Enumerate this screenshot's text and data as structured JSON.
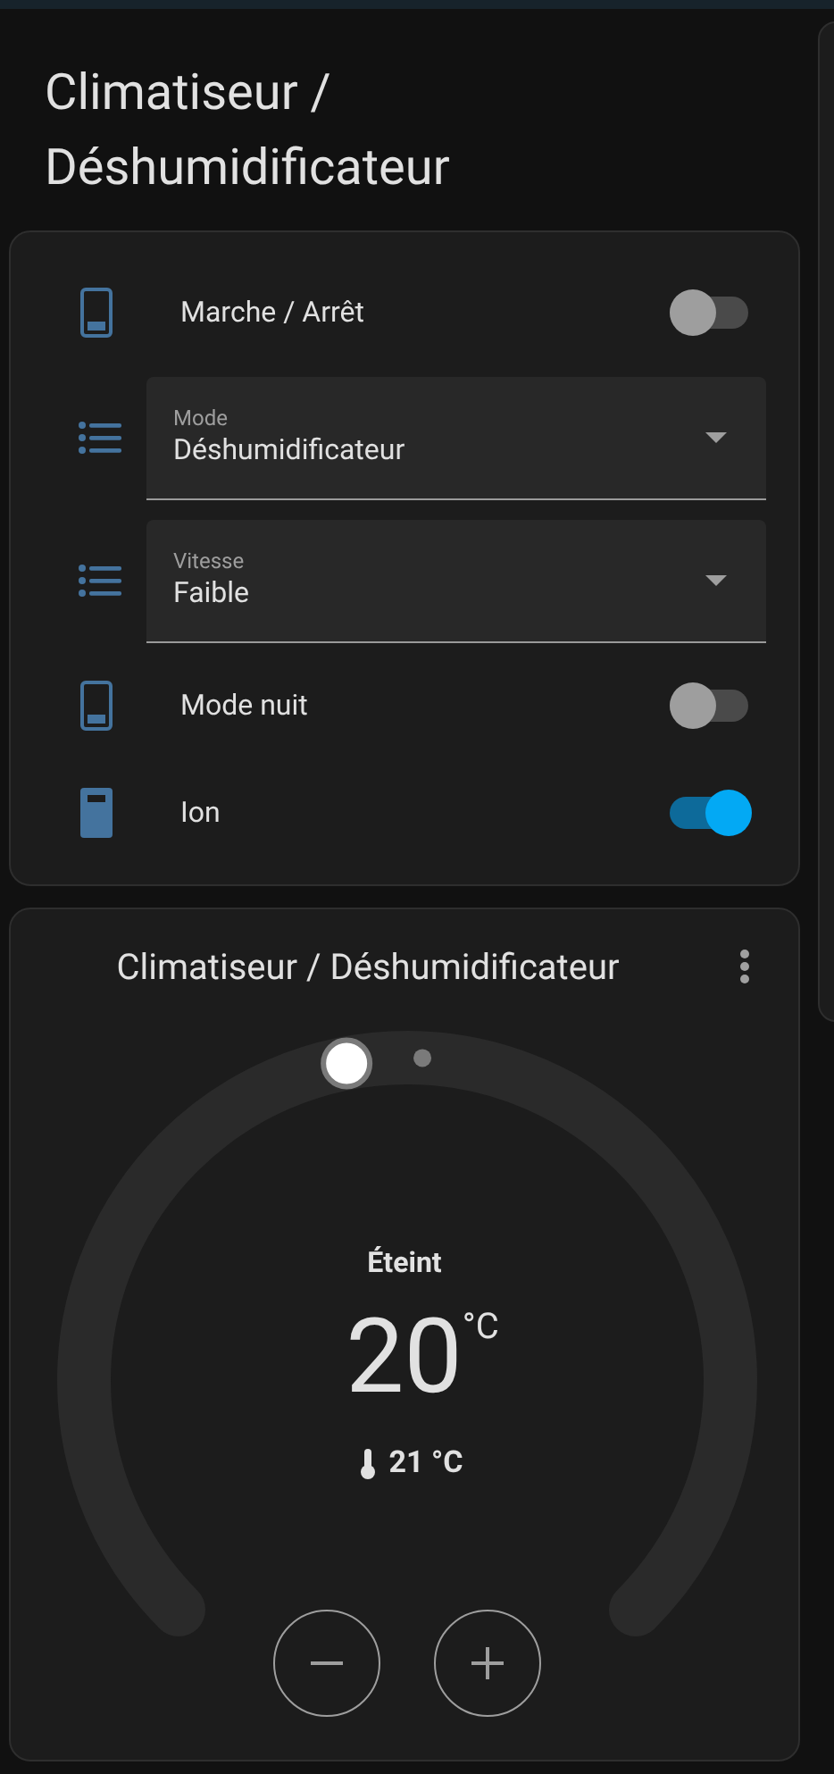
{
  "title": "Climatiseur / Déshumidificateur",
  "entities": [
    {
      "kind": "switch",
      "label": "Marche / Arrêt",
      "on": false
    },
    {
      "kind": "select",
      "label": "Mode",
      "value": "Déshumidificateur"
    },
    {
      "kind": "select",
      "label": "Vitesse",
      "value": "Faible"
    },
    {
      "kind": "switch",
      "label": "Mode nuit",
      "on": false
    },
    {
      "kind": "switch",
      "label": "Ion",
      "on": true
    }
  ],
  "thermostat": {
    "title": "Climatiseur / Déshumidificateur",
    "state": "Éteint",
    "target": "20",
    "unit": "°C",
    "current": "21 °C"
  }
}
